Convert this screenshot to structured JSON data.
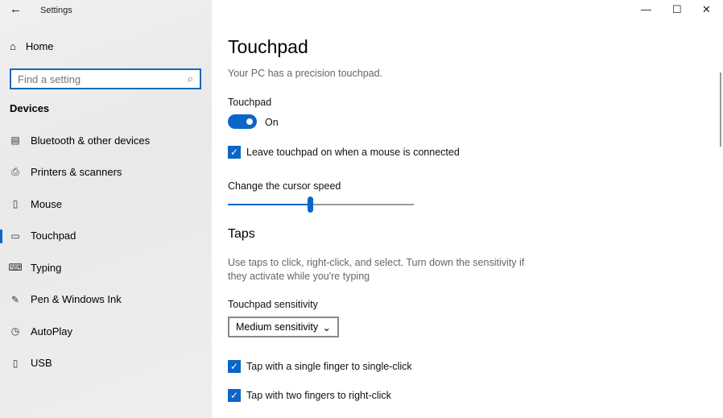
{
  "window": {
    "title": "Settings",
    "minimize_icon": "minimize-icon",
    "maximize_icon": "maximize-icon",
    "close_icon": "close-icon"
  },
  "sidebar": {
    "home": "Home",
    "search_placeholder": "Find a setting",
    "section": "Devices",
    "items": [
      {
        "label": "Bluetooth & other devices",
        "icon": "bluetooth-devices-icon"
      },
      {
        "label": "Printers & scanners",
        "icon": "printer-icon"
      },
      {
        "label": "Mouse",
        "icon": "mouse-icon"
      },
      {
        "label": "Touchpad",
        "icon": "touchpad-icon",
        "selected": true
      },
      {
        "label": "Typing",
        "icon": "keyboard-icon"
      },
      {
        "label": "Pen & Windows Ink",
        "icon": "pen-icon"
      },
      {
        "label": "AutoPlay",
        "icon": "autoplay-icon"
      },
      {
        "label": "USB",
        "icon": "usb-icon"
      }
    ]
  },
  "main": {
    "title": "Touchpad",
    "subtitle": "Your PC has a precision touchpad.",
    "toggle_label": "Touchpad",
    "toggle_state": "On",
    "toggle_on": true,
    "leave_on": {
      "label": "Leave touchpad on when a mouse is connected",
      "checked": true
    },
    "cursor_speed": {
      "label": "Change the cursor speed",
      "value_percent": 44
    },
    "taps": {
      "heading": "Taps",
      "description": "Use taps to click, right-click, and select. Turn down the sensitivity if they activate while you're typing",
      "sensitivity_label": "Touchpad sensitivity",
      "sensitivity_value": "Medium sensitivity",
      "single": {
        "label": "Tap with a single finger to single-click",
        "checked": true
      },
      "two": {
        "label": "Tap with two fingers to right-click",
        "checked": true
      }
    }
  },
  "colors": {
    "accent": "#0a66c8"
  }
}
